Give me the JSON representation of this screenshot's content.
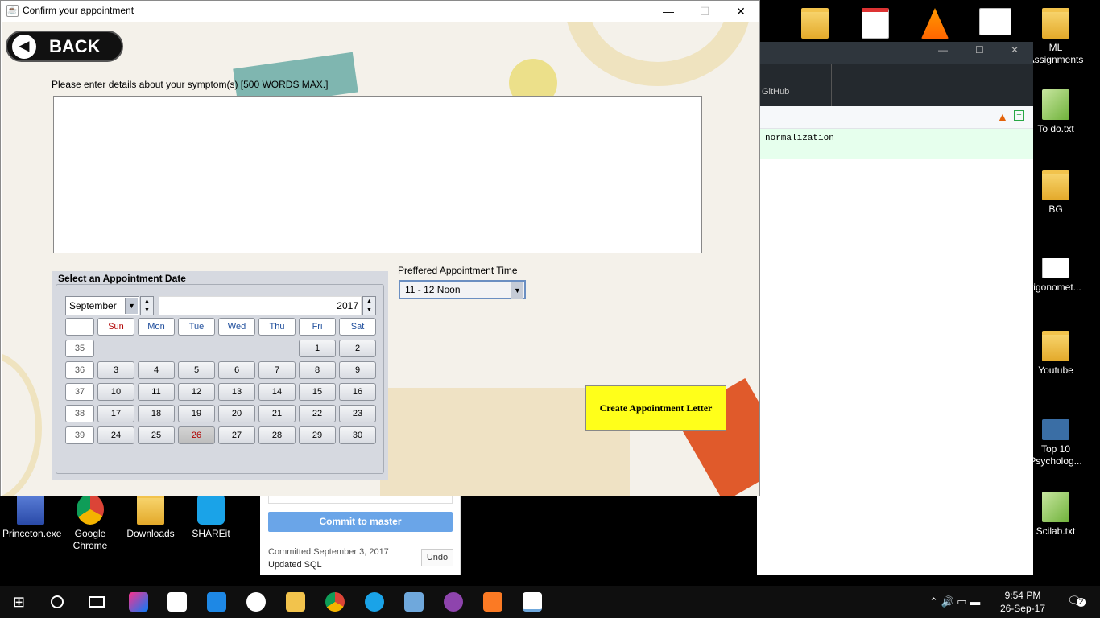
{
  "window": {
    "title": "Confirm your appointment"
  },
  "back_label": "BACK",
  "symptoms": {
    "label": "Please enter details about your symptom(s)   [500 WORDS MAX.]",
    "value": ""
  },
  "calendar": {
    "title": "Select an Appointment Date",
    "month": "September",
    "year": "2017",
    "day_headers": [
      "",
      "Sun",
      "Mon",
      "Tue",
      "Wed",
      "Thu",
      "Fri",
      "Sat"
    ],
    "weeks": [
      {
        "week": "35",
        "days": [
          "",
          "",
          "",
          "",
          "",
          "1",
          "2"
        ]
      },
      {
        "week": "36",
        "days": [
          "3",
          "4",
          "5",
          "6",
          "7",
          "8",
          "9"
        ]
      },
      {
        "week": "37",
        "days": [
          "10",
          "11",
          "12",
          "13",
          "14",
          "15",
          "16"
        ]
      },
      {
        "week": "38",
        "days": [
          "17",
          "18",
          "19",
          "20",
          "21",
          "22",
          "23"
        ]
      },
      {
        "week": "39",
        "days": [
          "24",
          "25",
          "26",
          "27",
          "28",
          "29",
          "30"
        ]
      }
    ],
    "selected_day": "26"
  },
  "time": {
    "label": "Preffered Appointment Time",
    "selected": "11 - 12 Noon"
  },
  "create_label": "Create Appointment Letter",
  "desktop_icons": [
    "ML Assignments",
    "To do.txt",
    "BG",
    "rigonomet...",
    "Youtube",
    "Top 10 Psycholog...",
    "Scilab.txt",
    "Princeton.exe",
    "Google Chrome",
    "Downloads",
    "SHAREit"
  ],
  "github": {
    "tab": "GitHub",
    "diff_text": "normalization",
    "commit_label": "Commit to master",
    "committed": "Committed September 3, 2017",
    "message": "Updated SQL",
    "undo": "Undo"
  },
  "clock": {
    "time": "9:54 PM",
    "date": "26-Sep-17"
  },
  "notification_count": "2"
}
